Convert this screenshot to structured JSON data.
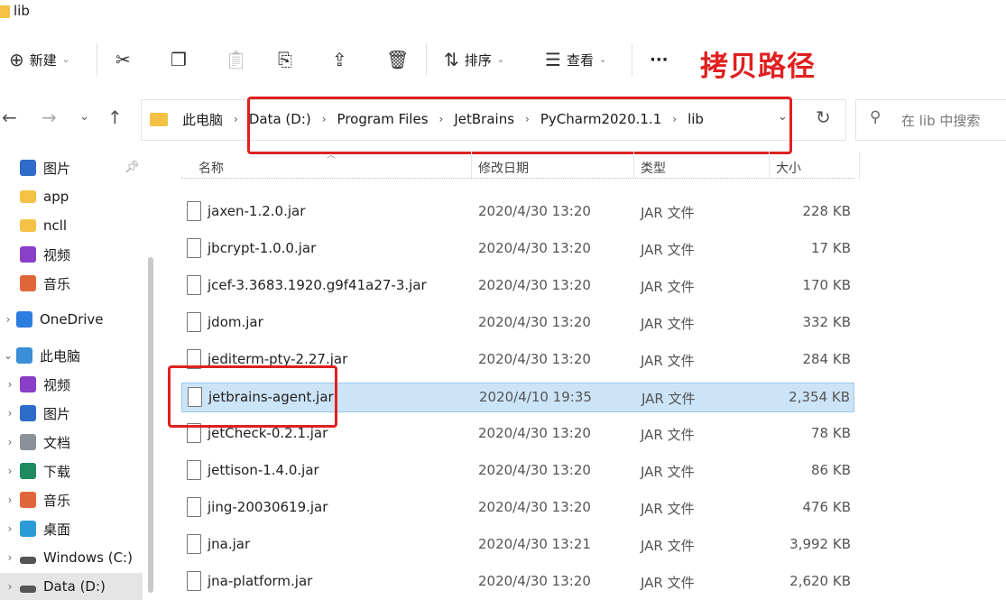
{
  "window": {
    "title": "lib"
  },
  "toolbar": {
    "new_label": "新建",
    "sort_label": "排序",
    "view_label": "查看",
    "more_label": "···",
    "annotation": "拷贝路径"
  },
  "address": {
    "crumbs": [
      "此电脑",
      "Data (D:)",
      "Program Files",
      "JetBrains",
      "PyCharm2020.1.1",
      "lib"
    ],
    "search_placeholder": "在 lib 中搜索"
  },
  "sidebar": {
    "items": [
      {
        "label": "图片",
        "icon": "pictures-icon",
        "color": "#2d6cc9"
      },
      {
        "label": "app",
        "icon": "folder-icon",
        "color": "#f3c244"
      },
      {
        "label": "ncll",
        "icon": "folder-icon",
        "color": "#f3c244"
      },
      {
        "label": "视频",
        "icon": "videos-icon",
        "color": "#8a3fc9"
      },
      {
        "label": "音乐",
        "icon": "music-icon",
        "color": "#e0673a"
      },
      {
        "label": "OneDrive",
        "icon": "cloud-icon",
        "color": "#2b7de0"
      },
      {
        "label": "此电脑",
        "icon": "pc-icon",
        "color": "#3a8fd6"
      },
      {
        "label": "视频",
        "icon": "videos-icon",
        "color": "#8a3fc9"
      },
      {
        "label": "图片",
        "icon": "pictures-icon",
        "color": "#2d6cc9"
      },
      {
        "label": "文档",
        "icon": "documents-icon",
        "color": "#8a9199"
      },
      {
        "label": "下载",
        "icon": "download-icon",
        "color": "#1f8a5e"
      },
      {
        "label": "音乐",
        "icon": "music-icon",
        "color": "#e0673a"
      },
      {
        "label": "桌面",
        "icon": "desktop-icon",
        "color": "#2a9bd6"
      },
      {
        "label": "Windows (C:)",
        "icon": "drive-icon",
        "color": "#555555"
      },
      {
        "label": "Data (D:)",
        "icon": "drive-icon",
        "color": "#555555"
      }
    ]
  },
  "columns": {
    "name": "名称",
    "modified": "修改日期",
    "type": "类型",
    "size": "大小"
  },
  "files": [
    {
      "name": "jaxen-1.2.0.jar",
      "modified": "2020/4/30 13:20",
      "type": "JAR 文件",
      "size": "228 KB"
    },
    {
      "name": "jbcrypt-1.0.0.jar",
      "modified": "2020/4/30 13:20",
      "type": "JAR 文件",
      "size": "17 KB"
    },
    {
      "name": "jcef-3.3683.1920.g9f41a27-3.jar",
      "modified": "2020/4/30 13:20",
      "type": "JAR 文件",
      "size": "170 KB"
    },
    {
      "name": "jdom.jar",
      "modified": "2020/4/30 13:20",
      "type": "JAR 文件",
      "size": "332 KB"
    },
    {
      "name": "jediterm-pty-2.27.jar",
      "modified": "2020/4/30 13:20",
      "type": "JAR 文件",
      "size": "284 KB"
    },
    {
      "name": "jetbrains-agent.jar",
      "modified": "2020/4/10 19:35",
      "type": "JAR 文件",
      "size": "2,354 KB"
    },
    {
      "name": "jetCheck-0.2.1.jar",
      "modified": "2020/4/30 13:20",
      "type": "JAR 文件",
      "size": "78 KB"
    },
    {
      "name": "jettison-1.4.0.jar",
      "modified": "2020/4/30 13:20",
      "type": "JAR 文件",
      "size": "86 KB"
    },
    {
      "name": "jing-20030619.jar",
      "modified": "2020/4/30 13:20",
      "type": "JAR 文件",
      "size": "476 KB"
    },
    {
      "name": "jna.jar",
      "modified": "2020/4/30 13:21",
      "type": "JAR 文件",
      "size": "3,992 KB"
    },
    {
      "name": "jna-platform.jar",
      "modified": "2020/4/30 13:20",
      "type": "JAR 文件",
      "size": "2,620 KB"
    }
  ]
}
